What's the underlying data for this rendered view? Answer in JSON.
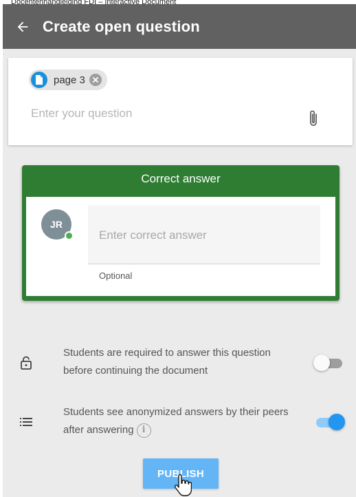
{
  "document_caption": "Docentenhandleiding FDI – Interactive Document",
  "header": {
    "title": "Create open question",
    "back_icon": "arrow-left-icon"
  },
  "question": {
    "attachment_chip": {
      "label": "page 3",
      "icon": "document-icon",
      "remove_icon": "close-circle-icon"
    },
    "placeholder": "Enter your question",
    "value": "",
    "attach_icon": "paperclip-icon"
  },
  "correct_answer": {
    "header": "Correct answer",
    "avatar_initials": "JR",
    "placeholder": "Enter correct answer",
    "value": "",
    "helper": "Optional"
  },
  "settings": [
    {
      "icon": "lock-icon",
      "text": "Students are required to answer this question before continuing the document",
      "enabled": false
    },
    {
      "icon": "list-icon",
      "text": "Students see anonymized answers by their peers after answering",
      "info_icon": "info-icon",
      "enabled": true
    }
  ],
  "publish_label": "PUBLISH",
  "colors": {
    "topbar": "#616161",
    "answer_card": "#2e7d32",
    "chip_doc": "#1a8fdc",
    "toggle_on": "#2196f3",
    "publish": "#64b5f6",
    "online": "#4caf50"
  }
}
